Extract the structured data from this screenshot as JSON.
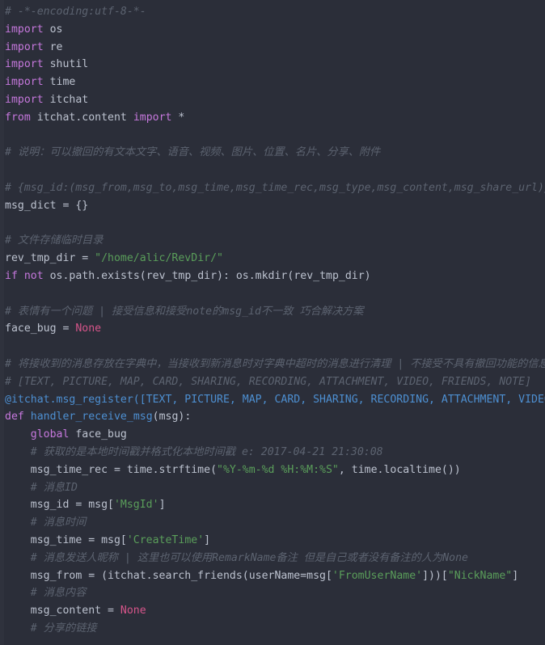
{
  "editor": {
    "language": "python",
    "theme": "dark",
    "background_color": "#2b2e39",
    "gutter_color": "#2f323d",
    "default_text_color": "#bcc2cf",
    "colors": {
      "comment": "#5c6370",
      "keyword": "#c678dd",
      "constant": "#d6558a",
      "string": "#5a9e5a",
      "function": "#4d8fd1",
      "decorator": "#4d8fd1",
      "plain": "#bcc2cf"
    }
  },
  "code": {
    "lines": [
      {
        "id": "line-1",
        "segments": [
          {
            "t": "# -*-encoding:utf-8-*-",
            "c": "cm"
          }
        ]
      },
      {
        "id": "line-2",
        "segments": [
          {
            "t": "import",
            "c": "kw"
          },
          {
            "t": " os",
            "c": "pl"
          }
        ]
      },
      {
        "id": "line-3",
        "segments": [
          {
            "t": "import",
            "c": "kw"
          },
          {
            "t": " re",
            "c": "pl"
          }
        ]
      },
      {
        "id": "line-4",
        "segments": [
          {
            "t": "import",
            "c": "kw"
          },
          {
            "t": " shutil",
            "c": "pl"
          }
        ]
      },
      {
        "id": "line-5",
        "segments": [
          {
            "t": "import",
            "c": "kw"
          },
          {
            "t": " time",
            "c": "pl"
          }
        ]
      },
      {
        "id": "line-6",
        "segments": [
          {
            "t": "import",
            "c": "kw"
          },
          {
            "t": " itchat",
            "c": "pl"
          }
        ]
      },
      {
        "id": "line-7",
        "segments": [
          {
            "t": "from",
            "c": "kw"
          },
          {
            "t": " itchat.content ",
            "c": "pl"
          },
          {
            "t": "import",
            "c": "kw"
          },
          {
            "t": " *",
            "c": "pl"
          }
        ]
      },
      {
        "id": "line-8",
        "segments": []
      },
      {
        "id": "line-9",
        "segments": [
          {
            "t": "# 说明：可以撤回的有文本文字、语音、视频、图片、位置、名片、分享、附件",
            "c": "cm"
          }
        ]
      },
      {
        "id": "line-10",
        "segments": []
      },
      {
        "id": "line-11",
        "segments": [
          {
            "t": "# {msg_id:(msg_from,msg_to,msg_time,msg_time_rec,msg_type,msg_content,msg_share_url)}",
            "c": "cm"
          }
        ]
      },
      {
        "id": "line-12",
        "segments": [
          {
            "t": "msg_dict = {}",
            "c": "pl"
          }
        ]
      },
      {
        "id": "line-13",
        "segments": []
      },
      {
        "id": "line-14",
        "segments": [
          {
            "t": "# 文件存储临时目录",
            "c": "cm"
          }
        ]
      },
      {
        "id": "line-15",
        "segments": [
          {
            "t": "rev_tmp_dir = ",
            "c": "pl"
          },
          {
            "t": "\"/home/alic/RevDir/\"",
            "c": "str"
          }
        ]
      },
      {
        "id": "line-16",
        "segments": [
          {
            "t": "if",
            "c": "kw"
          },
          {
            "t": " ",
            "c": "pl"
          },
          {
            "t": "not",
            "c": "kw"
          },
          {
            "t": " os.path.exists(rev_tmp_dir): os.mkdir(rev_tmp_dir)",
            "c": "pl"
          }
        ]
      },
      {
        "id": "line-17",
        "segments": []
      },
      {
        "id": "line-18",
        "segments": [
          {
            "t": "# 表情有一个问题 | 接受信息和接受note的msg_id不一致 巧合解决方案",
            "c": "cm"
          }
        ]
      },
      {
        "id": "line-19",
        "segments": [
          {
            "t": "face_bug = ",
            "c": "pl"
          },
          {
            "t": "None",
            "c": "cnst"
          }
        ]
      },
      {
        "id": "line-20",
        "segments": []
      },
      {
        "id": "line-21",
        "segments": [
          {
            "t": "# 将接收到的消息存放在字典中，当接收到新消息时对字典中超时的消息进行清理 | 不接受不具有撤回功能的信息",
            "c": "cm"
          }
        ]
      },
      {
        "id": "line-22",
        "segments": [
          {
            "t": "# [TEXT, PICTURE, MAP, CARD, SHARING, RECORDING, ATTACHMENT, VIDEO, FRIENDS, NOTE]",
            "c": "cm"
          }
        ]
      },
      {
        "id": "line-23",
        "segments": [
          {
            "t": "@itchat.msg_register([TEXT, PICTURE, MAP, CARD, SHARING, RECORDING, ATTACHMENT, VIDEO])",
            "c": "dec"
          }
        ]
      },
      {
        "id": "line-24",
        "segments": [
          {
            "t": "def",
            "c": "kw"
          },
          {
            "t": " ",
            "c": "pl"
          },
          {
            "t": "handler_receive_msg",
            "c": "fn"
          },
          {
            "t": "(msg):",
            "c": "pl"
          }
        ]
      },
      {
        "id": "line-25",
        "segments": [
          {
            "t": "    ",
            "c": "pl"
          },
          {
            "t": "global",
            "c": "kw"
          },
          {
            "t": " face_bug",
            "c": "pl"
          }
        ]
      },
      {
        "id": "line-26",
        "segments": [
          {
            "t": "    # 获取的是本地时间戳并格式化本地时间戳 e: 2017-04-21 21:30:08",
            "c": "cm"
          }
        ]
      },
      {
        "id": "line-27",
        "segments": [
          {
            "t": "    msg_time_rec = time.strftime(",
            "c": "pl"
          },
          {
            "t": "\"%Y-%m-%d %H:%M:%S\"",
            "c": "str"
          },
          {
            "t": ", time.localtime())",
            "c": "pl"
          }
        ]
      },
      {
        "id": "line-28",
        "segments": [
          {
            "t": "    # 消息ID",
            "c": "cm"
          }
        ]
      },
      {
        "id": "line-29",
        "segments": [
          {
            "t": "    msg_id = msg[",
            "c": "pl"
          },
          {
            "t": "'MsgId'",
            "c": "str"
          },
          {
            "t": "]",
            "c": "pl"
          }
        ]
      },
      {
        "id": "line-30",
        "segments": [
          {
            "t": "    # 消息时间",
            "c": "cm"
          }
        ]
      },
      {
        "id": "line-31",
        "segments": [
          {
            "t": "    msg_time = msg[",
            "c": "pl"
          },
          {
            "t": "'CreateTime'",
            "c": "str"
          },
          {
            "t": "]",
            "c": "pl"
          }
        ]
      },
      {
        "id": "line-32",
        "segments": [
          {
            "t": "    # 消息发送人昵称 | 这里也可以使用RemarkName备注 但是自己或者没有备注的人为None",
            "c": "cm"
          }
        ]
      },
      {
        "id": "line-33",
        "segments": [
          {
            "t": "    msg_from = (itchat.search_friends(userName=msg[",
            "c": "pl"
          },
          {
            "t": "'FromUserName'",
            "c": "str"
          },
          {
            "t": "]))[",
            "c": "pl"
          },
          {
            "t": "\"NickName\"",
            "c": "str"
          },
          {
            "t": "]",
            "c": "pl"
          }
        ]
      },
      {
        "id": "line-34",
        "segments": [
          {
            "t": "    # 消息内容",
            "c": "cm"
          }
        ]
      },
      {
        "id": "line-35",
        "segments": [
          {
            "t": "    msg_content = ",
            "c": "pl"
          },
          {
            "t": "None",
            "c": "cnst"
          }
        ]
      },
      {
        "id": "line-36",
        "segments": [
          {
            "t": "    # 分享的链接",
            "c": "cm"
          }
        ]
      }
    ]
  }
}
